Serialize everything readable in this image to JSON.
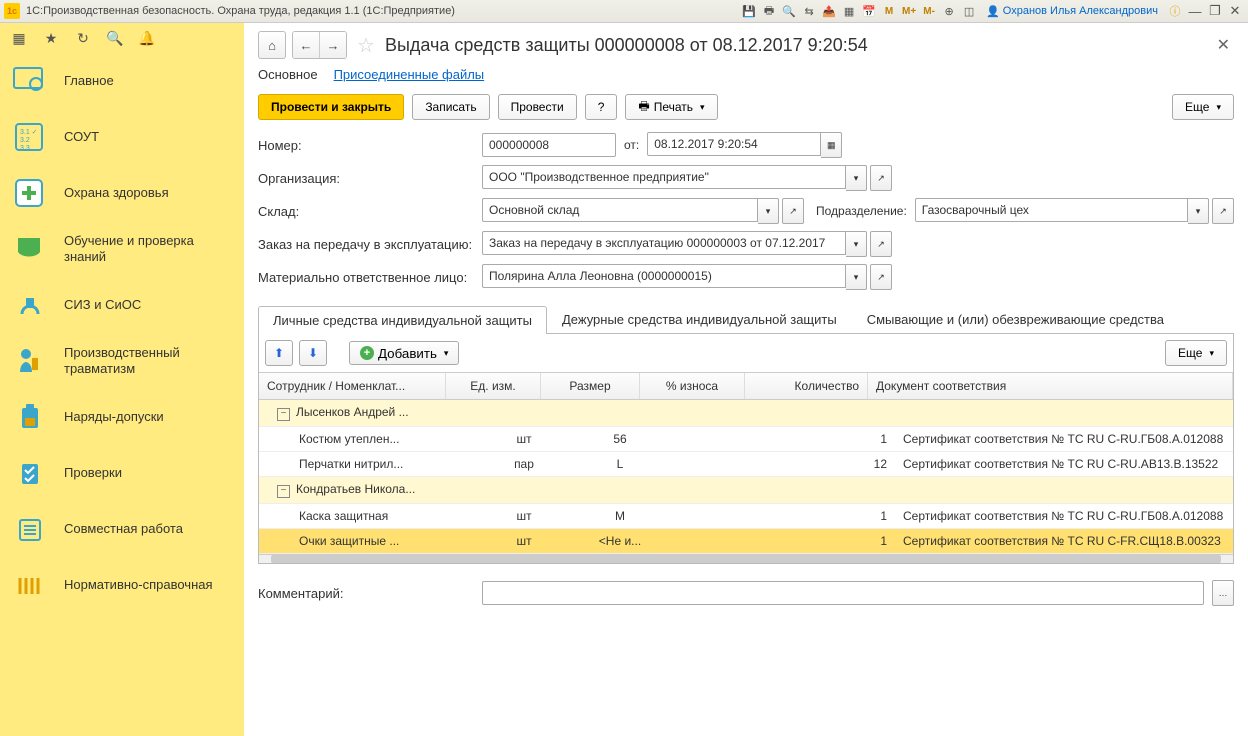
{
  "titlebar": {
    "app": "1С:Производственная безопасность. Охрана труда, редакция 1.1  (1С:Предприятие)",
    "user": "Охранов Илья Александрович"
  },
  "sidebar": {
    "items": [
      {
        "label": "Главное"
      },
      {
        "label": "СОУТ"
      },
      {
        "label": "Охрана здоровья"
      },
      {
        "label": "Обучение и проверка знаний"
      },
      {
        "label": "СИЗ и СиОС"
      },
      {
        "label": "Производственный травматизм"
      },
      {
        "label": "Наряды-допуски"
      },
      {
        "label": "Проверки"
      },
      {
        "label": "Совместная работа"
      },
      {
        "label": "Нормативно-справочная"
      }
    ]
  },
  "doc": {
    "title": "Выдача средств защиты 000000008 от 08.12.2017 9:20:54",
    "subtabs": {
      "main": "Основное",
      "files": "Присоединенные файлы"
    }
  },
  "toolbar": {
    "post_close": "Провести и закрыть",
    "save": "Записать",
    "post": "Провести",
    "help": "?",
    "print": "Печать",
    "more": "Еще"
  },
  "fields": {
    "number_label": "Номер:",
    "number": "000000008",
    "from": "от:",
    "date": "08.12.2017  9:20:54",
    "org_label": "Организация:",
    "org": "ООО \"Производственное предприятие\"",
    "warehouse_label": "Склад:",
    "warehouse": "Основной склад",
    "dept_label": "Подразделение:",
    "dept": "Газосварочный цех",
    "order_label": "Заказ на передачу в эксплуатацию:",
    "order": "Заказ на передачу в эксплуатацию 000000003 от 07.12.2017",
    "mol_label": "Материально ответственное лицо:",
    "mol": "Полярина Алла Леоновна (0000000015)"
  },
  "tabs": {
    "t1": "Личные средства индивидуальной защиты",
    "t2": "Дежурные средства индивидуальной защиты",
    "t3": "Смывающие и (или) обезвреживающие средства"
  },
  "grid": {
    "add": "Добавить",
    "more": "Еще",
    "headers": {
      "c1": "Сотрудник / Номенклат...",
      "c2": "Ед. изм.",
      "c3": "Размер",
      "c4": "% износа",
      "c5": "Количество",
      "c6": "Документ соответствия"
    },
    "rows": [
      {
        "type": "group",
        "c1": "Лысенков Андрей ..."
      },
      {
        "type": "item",
        "c1": "Костюм утеплен...",
        "c2": "шт",
        "c3": "56",
        "c4": "",
        "c5": "1",
        "c6": "Сертификат соответствия № ТС RU С-RU.ГБ08.А.012088"
      },
      {
        "type": "item",
        "c1": "Перчатки нитрил...",
        "c2": "пар",
        "c3": "L",
        "c4": "",
        "c5": "12",
        "c6": "Сертификат соответствия № ТС RU С-RU.АВ13.В.13522"
      },
      {
        "type": "group",
        "c1": "Кондратьев Никола..."
      },
      {
        "type": "item",
        "c1": "Каска защитная",
        "c2": "шт",
        "c3": "M",
        "c4": "",
        "c5": "1",
        "c6": "Сертификат соответствия № ТС RU С-RU.ГБ08.А.012088"
      },
      {
        "type": "item",
        "sel": true,
        "c1": "Очки защитные ...",
        "c2": "шт",
        "c3": "<Не и...",
        "c4": "",
        "c5": "1",
        "c6": "Сертификат соответствия № ТС RU С-FR.СЩ18.В.00323"
      }
    ]
  },
  "comment": {
    "label": "Комментарий:",
    "value": ""
  }
}
